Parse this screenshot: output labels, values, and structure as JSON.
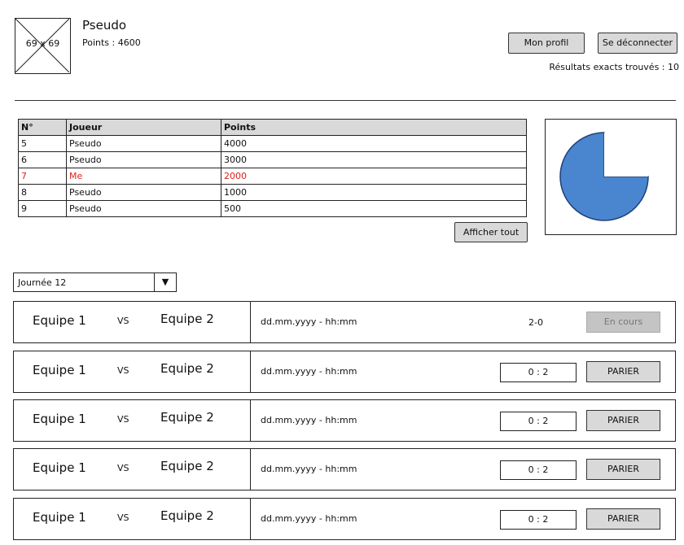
{
  "header": {
    "avatar_placeholder": "69 x 69",
    "username": "Pseudo",
    "points": "Points : 4600",
    "profile_button": "Mon profil",
    "logout_button": "Se déconnecter",
    "exact_results": "Résultats exacts trouvés : 10"
  },
  "ranking": {
    "columns": [
      "N°",
      "Joueur",
      "Points"
    ],
    "rows": [
      {
        "rank": "5",
        "player": "Pseudo",
        "points": "4000",
        "highlight": false
      },
      {
        "rank": "6",
        "player": "Pseudo",
        "points": "3000",
        "highlight": false
      },
      {
        "rank": "7",
        "player": "Me",
        "points": "2000",
        "highlight": true
      },
      {
        "rank": "8",
        "player": "Pseudo",
        "points": "1000",
        "highlight": false
      },
      {
        "rank": "9",
        "player": "Pseudo",
        "points": "500",
        "highlight": false
      }
    ],
    "show_all_button": "Afficher tout",
    "highlight_color": "#e0201a"
  },
  "chart_data": {
    "type": "pie",
    "slices": [
      {
        "value": 75,
        "color": "#4a86cf"
      },
      {
        "value": 25,
        "color": "#ffffff"
      }
    ]
  },
  "matchday": {
    "selected": "Journée 12",
    "arrow": "▼"
  },
  "matches": [
    {
      "team1": "Equipe 1",
      "vs": "VS",
      "team2": "Equipe 2",
      "datetime": "dd.mm.yyyy - hh:mm",
      "score": "2-0",
      "action": "En cours",
      "state": "live"
    },
    {
      "team1": "Equipe 1",
      "vs": "VS",
      "team2": "Equipe 2",
      "datetime": "dd.mm.yyyy - hh:mm",
      "score": "0 : 2",
      "action": "PARIER",
      "state": "bet"
    },
    {
      "team1": "Equipe 1",
      "vs": "VS",
      "team2": "Equipe 2",
      "datetime": "dd.mm.yyyy - hh:mm",
      "score": "0 : 2",
      "action": "PARIER",
      "state": "bet"
    },
    {
      "team1": "Equipe 1",
      "vs": "VS",
      "team2": "Equipe 2",
      "datetime": "dd.mm.yyyy - hh:mm",
      "score": "0 : 2",
      "action": "PARIER",
      "state": "bet"
    },
    {
      "team1": "Equipe 1",
      "vs": "VS",
      "team2": "Equipe 2",
      "datetime": "dd.mm.yyyy - hh:mm",
      "score": "0 : 2",
      "action": "PARIER",
      "state": "bet"
    }
  ]
}
